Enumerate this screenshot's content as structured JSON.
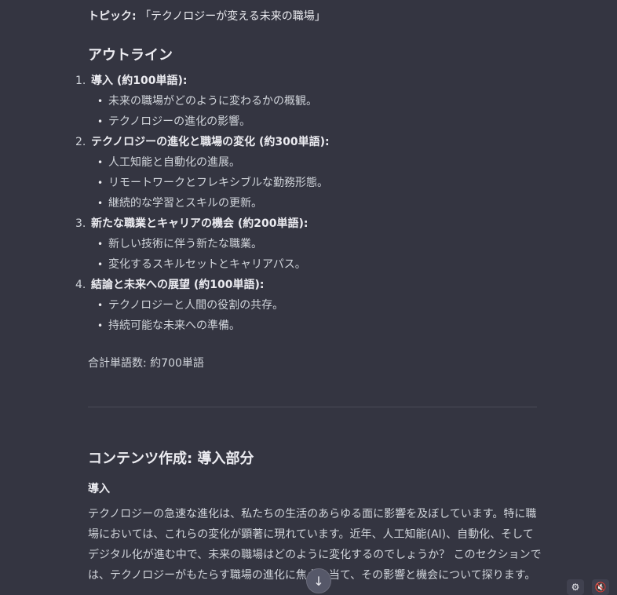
{
  "topic": {
    "label": "トピック:",
    "value": "「テクノロジーが変える未来の職場」"
  },
  "outline": {
    "heading": "アウトライン",
    "sections": [
      {
        "num": "1.",
        "title": "導入 (約100単語):",
        "items": [
          "未来の職場がどのように変わるかの概観。",
          "テクノロジーの進化の影響。"
        ]
      },
      {
        "num": "2.",
        "title": "テクノロジーの進化と職場の変化 (約300単語):",
        "items": [
          "人工知能と自動化の進展。",
          "リモートワークとフレキシブルな勤務形態。",
          "継続的な学習とスキルの更新。"
        ]
      },
      {
        "num": "3.",
        "title": "新たな職業とキャリアの機会 (約200単語):",
        "items": [
          "新しい技術に伴う新たな職業。",
          "変化するスキルセットとキャリアパス。"
        ]
      },
      {
        "num": "4.",
        "title": "結論と未来への展望 (約100単語):",
        "items": [
          "テクノロジーと人間の役割の共存。",
          "持続可能な未来への準備。"
        ]
      }
    ],
    "total": "合計単語数: 約700単語"
  },
  "content": {
    "heading": "コンテンツ作成: 導入部分",
    "intro_label": "導入",
    "paragraph": "テクノロジーの急速な進化は、私たちの生活のあらゆる面に影響を及ぼしています。特に職場においては、これらの変化が顕著に現れています。近年、人工知能(AI)、自動化、そしてデジタル化が進む中で、未来の職場はどのように変化するのでしょうか？ このセクションでは、テクノロジーがもたらす職場の進化に焦点を当て、その影響と機会について探ります。"
  },
  "controls": {
    "scroll_down_glyph": "↓",
    "settings_glyph": "⚙",
    "mute_glyph": "🔇"
  }
}
